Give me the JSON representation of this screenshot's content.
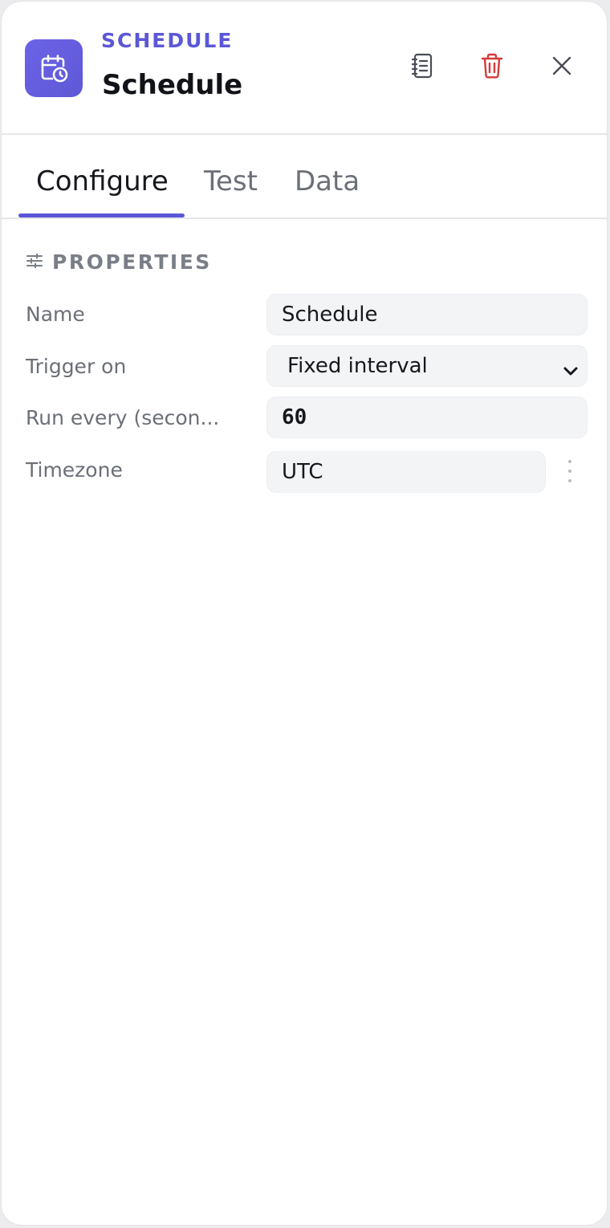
{
  "header": {
    "node_type": "SCHEDULE",
    "node_title": "Schedule",
    "icons": {
      "node": "calendar-clock-icon",
      "docs": "notebook-icon",
      "delete": "trash-icon",
      "close": "close-icon"
    },
    "accent_color": "#5b57d6",
    "delete_color": "#d63a3a"
  },
  "tabs": [
    {
      "label": "Configure",
      "active": true
    },
    {
      "label": "Test",
      "active": false
    },
    {
      "label": "Data",
      "active": false
    }
  ],
  "properties": {
    "section_title": "PROPERTIES",
    "section_icon": "sliders-icon",
    "fields": [
      {
        "label": "Name",
        "value": "Schedule"
      },
      {
        "label": "Trigger on",
        "value": "Fixed interval"
      },
      {
        "label": "Run every (secon...",
        "value": "60"
      },
      {
        "label": "Timezone",
        "value": "UTC"
      }
    ]
  }
}
